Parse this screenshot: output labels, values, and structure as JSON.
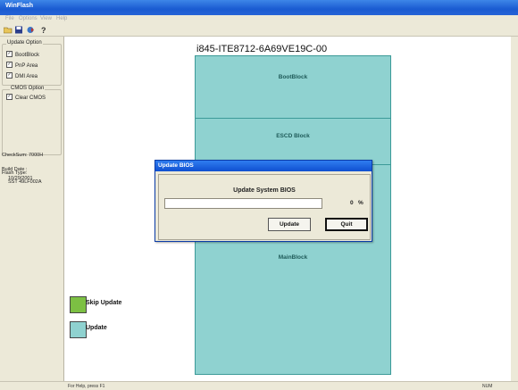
{
  "window": {
    "title": "WinFlash"
  },
  "menu": [
    "File",
    "Options",
    "View",
    "Help"
  ],
  "toolbar": {
    "icons": [
      "open-icon",
      "save-icon",
      "flash-icon",
      "help-icon"
    ]
  },
  "left_panel": {
    "update_option": {
      "title": "Update Option",
      "items": [
        {
          "label": "BootBlock",
          "checked": true
        },
        {
          "label": "PnP Area",
          "checked": true
        },
        {
          "label": "DMI Area",
          "checked": true
        }
      ]
    },
    "cmos_option": {
      "title": "CMOS Option",
      "items": [
        {
          "label": "Clear CMOS",
          "checked": true
        }
      ]
    },
    "checksum": "CheckSum:  7000H",
    "build_date_label": "Build Date :",
    "build_date": "10/29/2001",
    "flash_type_label": "Flash Type:",
    "flash_type": "SST 49LF002A"
  },
  "diagram": {
    "title": "i845-ITE8712-6A69VE19C-00",
    "blocks": [
      "BootBlock",
      "ESCD Block",
      "MainBlock"
    ],
    "block_color": "#8fd2d0"
  },
  "legend": [
    {
      "label": "Skip Update",
      "color": "#7cc043"
    },
    {
      "label": "Update",
      "color": "#8fd2d0"
    }
  ],
  "dialog": {
    "title": "Update BIOS",
    "message": "Update System BIOS",
    "progress_value": "0",
    "progress_unit": "%",
    "progress_fraction": 0,
    "update_button": "Update",
    "quit_button": "Quit"
  },
  "statusbar": {
    "text": "For Help, press F1",
    "num": "NUM"
  }
}
